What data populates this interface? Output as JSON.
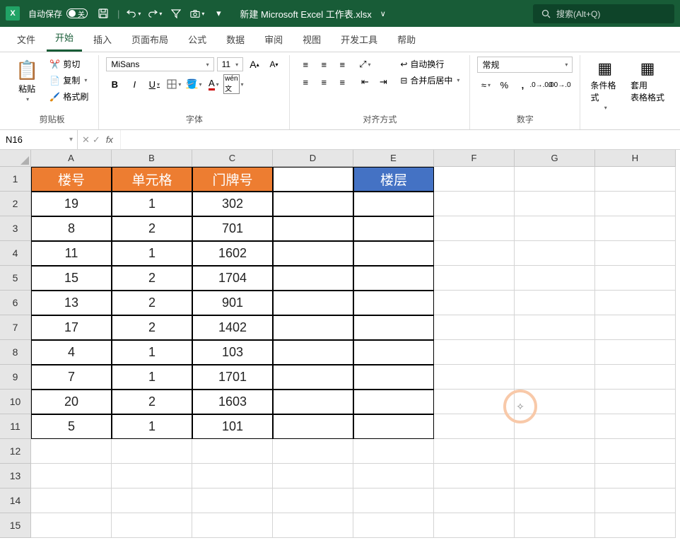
{
  "titlebar": {
    "app_icon": "X",
    "autosave_label": "自动保存",
    "autosave_state": "关",
    "filename": "新建 Microsoft Excel 工作表.xlsx",
    "search_placeholder": "搜索(Alt+Q)"
  },
  "tabs": [
    "文件",
    "开始",
    "插入",
    "页面布局",
    "公式",
    "数据",
    "审阅",
    "视图",
    "开发工具",
    "帮助"
  ],
  "ribbon": {
    "clipboard": {
      "paste": "粘贴",
      "cut": "剪切",
      "copy": "复制",
      "format_painter": "格式刷",
      "label": "剪贴板"
    },
    "font": {
      "name": "MiSans",
      "size": "11",
      "label": "字体"
    },
    "alignment": {
      "wrap": "自动换行",
      "merge": "合并后居中",
      "label": "对齐方式"
    },
    "number": {
      "format": "常规",
      "label": "数字"
    },
    "styles": {
      "cond_format": "条件格式",
      "table_format": "套用\n表格格式"
    }
  },
  "formula_bar": {
    "name_box": "N16",
    "formula": ""
  },
  "columns": [
    "A",
    "B",
    "C",
    "D",
    "E",
    "F",
    "G",
    "H"
  ],
  "rows": [
    "1",
    "2",
    "3",
    "4",
    "5",
    "6",
    "7",
    "8",
    "9",
    "10",
    "11",
    "12",
    "13",
    "14",
    "15"
  ],
  "headers": {
    "A1": "楼号",
    "B1": "单元格",
    "C1": "门牌号",
    "E1": "楼层"
  },
  "table_data": [
    {
      "A": "19",
      "B": "1",
      "C": "302"
    },
    {
      "A": "8",
      "B": "2",
      "C": "701"
    },
    {
      "A": "11",
      "B": "1",
      "C": "1602"
    },
    {
      "A": "15",
      "B": "2",
      "C": "1704"
    },
    {
      "A": "13",
      "B": "2",
      "C": "901"
    },
    {
      "A": "17",
      "B": "2",
      "C": "1402"
    },
    {
      "A": "4",
      "B": "1",
      "C": "103"
    },
    {
      "A": "7",
      "B": "1",
      "C": "1701"
    },
    {
      "A": "20",
      "B": "2",
      "C": "1603"
    },
    {
      "A": "5",
      "B": "1",
      "C": "101"
    }
  ]
}
